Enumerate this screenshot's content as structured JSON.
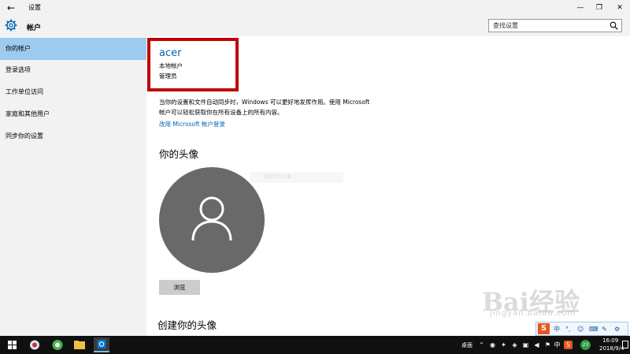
{
  "window": {
    "title": "设置",
    "back_glyph": "←",
    "min_glyph": "—",
    "max_glyph": "❐",
    "close_glyph": "✕"
  },
  "header": {
    "section_title": "帐户",
    "search_placeholder": "查找设置"
  },
  "sidebar": {
    "items": [
      {
        "label": "你的帐户",
        "active": true
      },
      {
        "label": "登录选项",
        "active": false
      },
      {
        "label": "工作单位访问",
        "active": false
      },
      {
        "label": "家庭和其他用户",
        "active": false
      },
      {
        "label": "同步你的设置",
        "active": false
      }
    ]
  },
  "main": {
    "user_name": "acer",
    "account_type": "本地帐户",
    "account_role": "管理员",
    "description": "当你的设置和文件自动同步时，Windows 可以更好地发挥作用。使用 Microsoft 帐户可以轻松获取你在所有设备上的所有内容。",
    "ms_link": "改用 Microsoft 帐户登录",
    "avatar_heading": "你的头像",
    "faint_tooltip": "选择你的头像",
    "browse_button": "浏览",
    "create_heading": "创建你的头像",
    "highlight_color": "#c00000",
    "accent_color": "#0063b1"
  },
  "watermark": {
    "text": "Bai经验",
    "sub": "jingyan.baidu.com"
  },
  "ime": {
    "logo": "S",
    "items": [
      "中",
      "°,",
      "☺",
      "⌨",
      "✎",
      "⚙"
    ]
  },
  "taskbar": {
    "desktop_label": "桌面",
    "tray_ime": "中",
    "tray_badge": "23",
    "time": "16:09",
    "date": "2018/9/4"
  }
}
